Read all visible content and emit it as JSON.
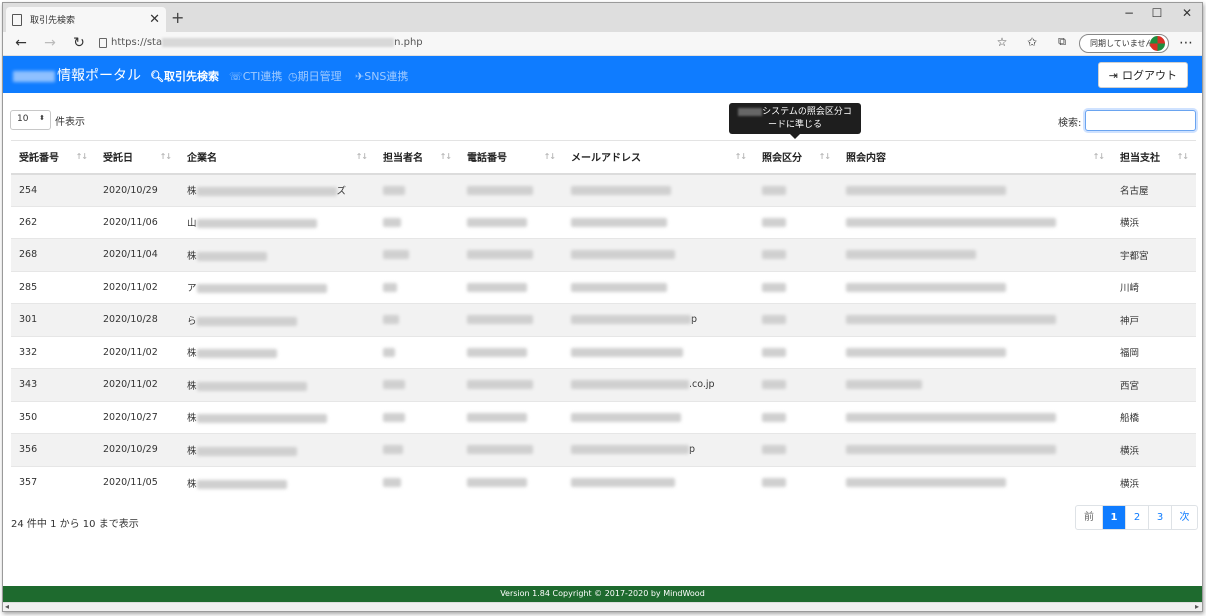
{
  "browser": {
    "tab_title": "取引先検索",
    "tab_close": "✕",
    "new_tab": "+",
    "url_prefix": "https://sta",
    "url_suffix": "n.php",
    "sync_label": "同期していません",
    "win_minimize": "−",
    "win_maximize": "☐",
    "win_close": "✕",
    "icons": [
      "back-icon",
      "forward-icon",
      "refresh-icon",
      "lock-icon",
      "star-icon",
      "favorites-icon",
      "collections-icon",
      "more-icon"
    ]
  },
  "header": {
    "brand": "情報ポータル",
    "nav": [
      {
        "label": "取引先検索",
        "icon": "search-icon",
        "active": true
      },
      {
        "label": "CTI連携",
        "icon": "cti-icon",
        "active": false
      },
      {
        "label": "期日管理",
        "icon": "clock-icon",
        "active": false
      },
      {
        "label": "SNS連携",
        "icon": "twitter-icon",
        "active": false
      }
    ],
    "logout": "ログアウト",
    "accent": "#0f7cff"
  },
  "controls": {
    "page_length": "10",
    "page_length_suffix": "件表示",
    "search_label": "検索:",
    "search_value": ""
  },
  "tooltip": {
    "line1": "システムの照会区分コ",
    "line2": "ードに準じる"
  },
  "table": {
    "columns": [
      "受託番号",
      "受託日",
      "企業名",
      "担当者名",
      "電話番号",
      "メールアドレス",
      "照会区分",
      "照会内容",
      "担当支社"
    ],
    "rows": [
      {
        "no": "254",
        "date": "2020/10/29",
        "company": "株",
        "company_tail": "ズ",
        "email_tail": "",
        "branch": "名古屋"
      },
      {
        "no": "262",
        "date": "2020/11/06",
        "company": "山",
        "company_tail": "",
        "email_tail": "",
        "branch": "横浜"
      },
      {
        "no": "268",
        "date": "2020/11/04",
        "company": "株",
        "company_tail": "",
        "email_tail": "",
        "branch": "宇都宮"
      },
      {
        "no": "285",
        "date": "2020/11/02",
        "company": "ア",
        "company_tail": "",
        "email_tail": "",
        "branch": "川崎"
      },
      {
        "no": "301",
        "date": "2020/10/28",
        "company": "ら",
        "company_tail": "",
        "email_tail": "p",
        "branch": "神戸"
      },
      {
        "no": "332",
        "date": "2020/11/02",
        "company": "株",
        "company_tail": "",
        "email_tail": "",
        "branch": "福岡"
      },
      {
        "no": "343",
        "date": "2020/11/02",
        "company": "株",
        "company_tail": "",
        "email_tail": ".co.jp",
        "branch": "西宮"
      },
      {
        "no": "350",
        "date": "2020/10/27",
        "company": "株",
        "company_tail": "",
        "email_tail": "",
        "branch": "船橋"
      },
      {
        "no": "356",
        "date": "2020/10/29",
        "company": "株",
        "company_tail": "",
        "email_tail": "p",
        "branch": "横浜"
      },
      {
        "no": "357",
        "date": "2020/11/05",
        "company": "株",
        "company_tail": "",
        "email_tail": "",
        "branch": "横浜"
      }
    ]
  },
  "info": "24 件中 1 から 10 まで表示",
  "pagination": {
    "prev": "前",
    "pages": [
      "1",
      "2",
      "3"
    ],
    "current": "1",
    "next": "次"
  },
  "footer": "Version 1.84 Copyright © 2017-2020 by MindWood"
}
